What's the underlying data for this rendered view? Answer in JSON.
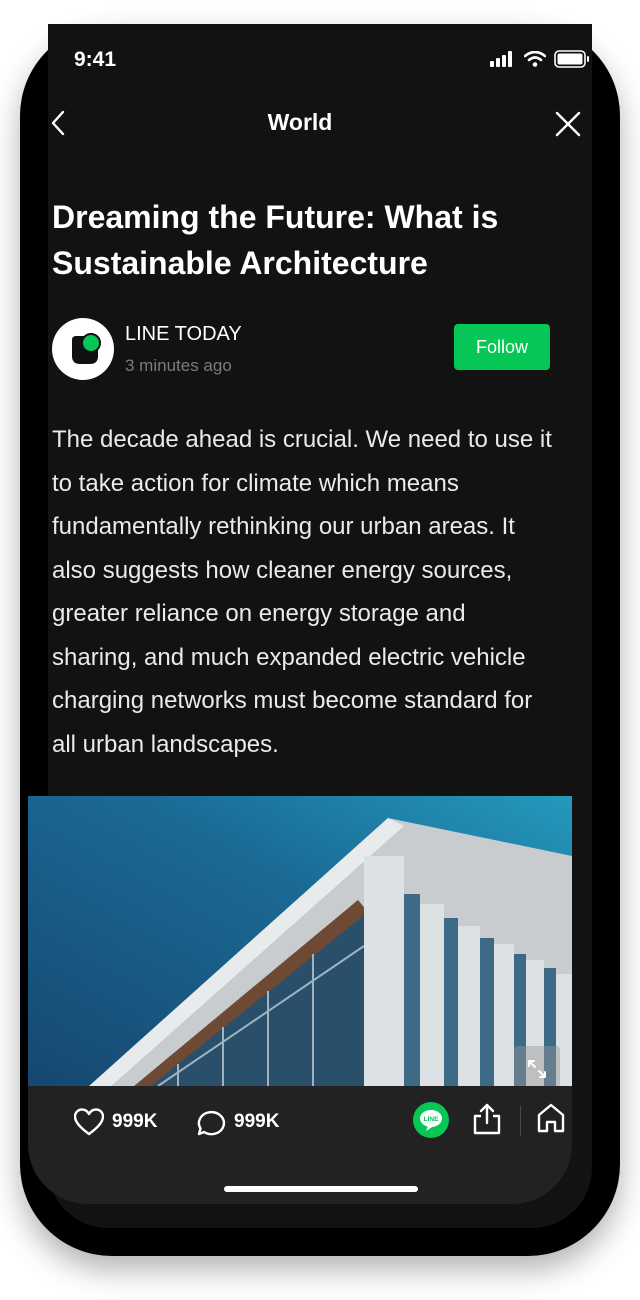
{
  "status_bar": {
    "time": "9:41"
  },
  "nav": {
    "title": "World"
  },
  "article": {
    "headline": "Dreaming the Future: What is Sustainable Architecture",
    "author": {
      "name": "LINE TODAY",
      "time": "3 minutes ago"
    },
    "follow_label": "Follow",
    "body": "The decade ahead is crucial. We need to use it to take action for climate which means fundamentally rethinking our urban areas. It also suggests how cleaner energy sources, greater reliance on energy storage and sharing, and much expanded electric vehicle charging networks must become standard for all urban landscapes."
  },
  "actions": {
    "likes": "999K",
    "comments": "999K",
    "line_badge": "LINE"
  },
  "colors": {
    "background": "#121212",
    "accent": "#06c755",
    "action_bar": "#222222"
  },
  "icons": [
    "back-icon",
    "close-icon",
    "heart-icon",
    "comment-icon",
    "line-icon",
    "share-icon",
    "home-icon",
    "expand-icon",
    "signal-icon",
    "wifi-icon",
    "battery-icon"
  ]
}
